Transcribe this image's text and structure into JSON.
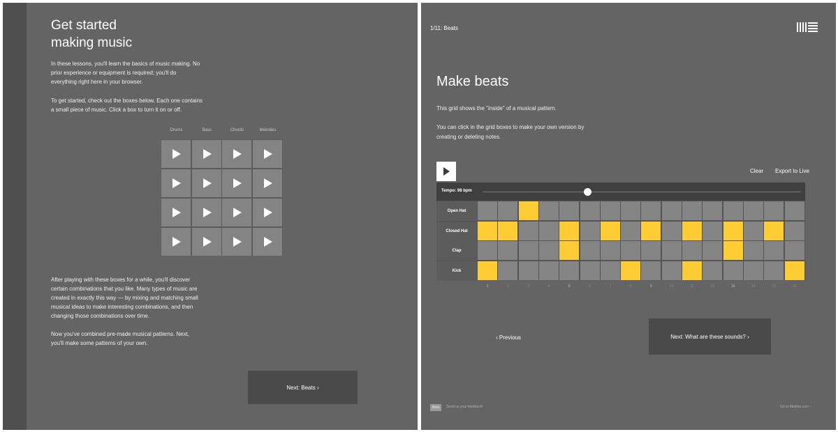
{
  "left": {
    "title_lines": [
      "Get started",
      "making music"
    ],
    "intro_lines": [
      "In these lessons, you'll learn the basics of music making. No",
      "prior experience or equipment is required; you'll do",
      "everything right here in your browser."
    ],
    "instruction_lines": [
      "To get started, check out the boxes below. Each one contains",
      "a small piece of music. Click a box to turn it on or off."
    ],
    "columns": [
      "Drums",
      "Bass",
      "Chords",
      "Melodies"
    ],
    "rows": 4,
    "after_lines": [
      "After playing with these boxes for a while, you'll discover",
      "certain combinations that you like. Many types of music are",
      "created in exactly this way — by mixing and matching small",
      "musical ideas to make interesting combinations, and then",
      "changing those combinations over time."
    ],
    "final_lines": [
      "Now you've combined pre-made musical patterns. Next,",
      "you'll make some patterns of your own."
    ],
    "next_label": "Next: Beats ›"
  },
  "right": {
    "breadcrumb": "1/11: Beats",
    "title": "Make beats",
    "desc1": "This grid shows the \"inside\" of a musical pattern.",
    "desc2_lines": [
      "You can click in the grid boxes to make your own version by",
      "creating or deleting notes."
    ],
    "clear_label": "Clear",
    "export_label": "Export to Live",
    "tempo_label": "Tempo: 98 bpm",
    "tempo_bpm": 98,
    "tempo_slider_fraction": 0.33,
    "sequencer": {
      "steps": 16,
      "rows": [
        {
          "name": "Open Hat",
          "active": [
            3
          ]
        },
        {
          "name": "Closed Hat",
          "active": [
            1,
            2,
            5,
            7,
            9,
            11,
            13,
            15
          ]
        },
        {
          "name": "Clap",
          "active": [
            5,
            13
          ]
        },
        {
          "name": "Kick",
          "active": [
            1,
            8,
            11,
            16
          ]
        }
      ]
    },
    "step_numbers": [
      "1",
      "2",
      "3",
      "4",
      "5",
      "6",
      "7",
      "8",
      "9",
      "10",
      "11",
      "12",
      "13",
      "14",
      "15",
      "16"
    ],
    "prev_label": "‹ Previous",
    "next_label": "Next: What are these sounds? ›",
    "beta_label": "Beta",
    "feedback_label": "Send us your feedback!",
    "ableton_label": "Go to Ableton.com ›"
  },
  "colors": {
    "panel": "#646464",
    "active_step": "#ffcc33",
    "inactive_step": "#858585",
    "clip": "#848484",
    "button_dark": "#4a4a4a"
  }
}
